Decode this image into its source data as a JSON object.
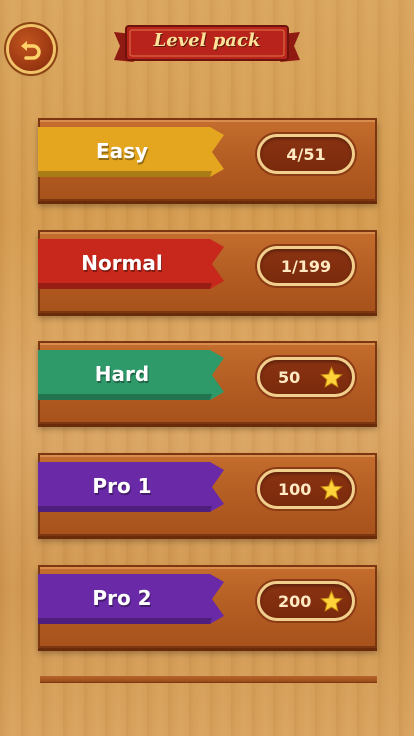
{
  "header": {
    "title": "Level pack",
    "back_icon": "back-arrow-icon"
  },
  "packs": [
    {
      "label": "Easy",
      "value": "4/51",
      "color": "#e3a61e",
      "star": false
    },
    {
      "label": "Normal",
      "value": "1/199",
      "color": "#c8281c",
      "star": false
    },
    {
      "label": "Hard",
      "value": "50",
      "color": "#2e9a6a",
      "star": true
    },
    {
      "label": "Pro 1",
      "value": "100",
      "color": "#6a2aa8",
      "star": true
    },
    {
      "label": "Pro 2",
      "value": "200",
      "color": "#6a2aa8",
      "star": true
    }
  ],
  "colors": {
    "wood_bg": "#d9a55e",
    "board": "#b55f24",
    "pill_border": "#f1cf8d",
    "title_red": "#b8241c"
  }
}
